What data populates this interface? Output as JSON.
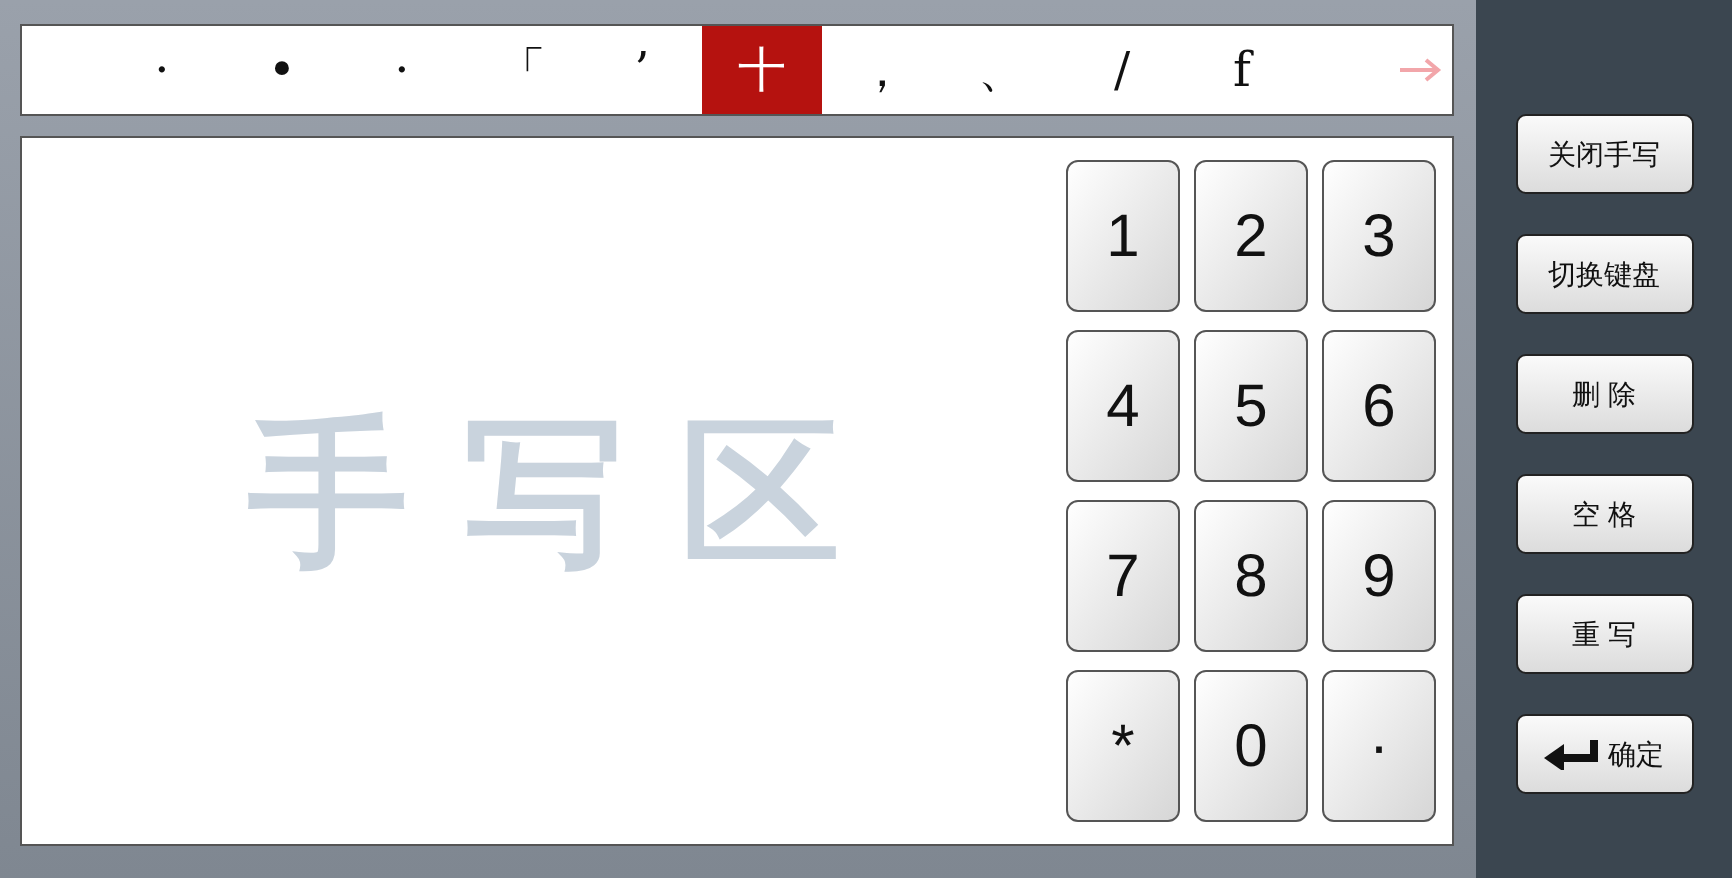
{
  "candidates": [
    {
      "text": "·",
      "selected": false
    },
    {
      "text": "•",
      "selected": false
    },
    {
      "text": "·",
      "selected": false
    },
    {
      "text": "「",
      "selected": false
    },
    {
      "text": "’",
      "selected": false
    },
    {
      "text": "十",
      "selected": true
    },
    {
      "text": "，",
      "selected": false
    },
    {
      "text": "、",
      "selected": false
    },
    {
      "text": "/",
      "selected": false
    },
    {
      "text": "f",
      "selected": false
    }
  ],
  "writing_area": {
    "hint": "手 写 区"
  },
  "keypad": [
    "1",
    "2",
    "3",
    "4",
    "5",
    "6",
    "7",
    "8",
    "9",
    "*",
    "0",
    "·"
  ],
  "buttons": [
    {
      "label": "关闭手写",
      "kind": "text"
    },
    {
      "label": "切换键盘",
      "kind": "text"
    },
    {
      "label": "删 除",
      "kind": "text"
    },
    {
      "label": "空 格",
      "kind": "text"
    },
    {
      "label": "重 写",
      "kind": "text"
    },
    {
      "label": "确定",
      "kind": "enter"
    }
  ]
}
